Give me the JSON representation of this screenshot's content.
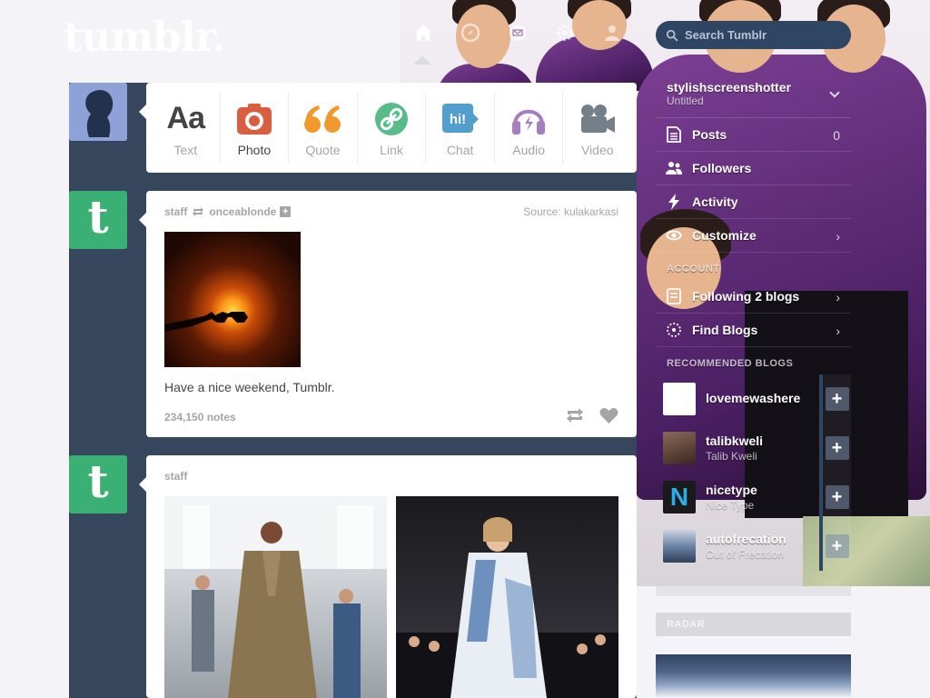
{
  "header": {
    "logo": "tumblr.",
    "search_placeholder": "Search Tumblr",
    "nav_icons": [
      "home-icon",
      "compass-icon",
      "mail-icon",
      "gear-icon",
      "user-icon"
    ]
  },
  "post_types": [
    {
      "label": "Text",
      "icon": "text-icon"
    },
    {
      "label": "Photo",
      "icon": "camera-icon"
    },
    {
      "label": "Quote",
      "icon": "quote-icon"
    },
    {
      "label": "Link",
      "icon": "link-icon"
    },
    {
      "label": "Chat",
      "icon": "chat-icon"
    },
    {
      "label": "Audio",
      "icon": "headphones-icon"
    },
    {
      "label": "Video",
      "icon": "video-camera-icon"
    }
  ],
  "posts": [
    {
      "author": "staff",
      "reblogged_from": "onceablonde",
      "source": "Source: kulakarkasi",
      "caption": "Have a nice weekend, Tumblr.",
      "notes": "234,150 notes"
    },
    {
      "author": "staff"
    }
  ],
  "sidebar": {
    "blog_name": "stylishscreenshotter",
    "blog_sub": "Untitled",
    "items": [
      {
        "label": "Posts",
        "icon": "posts-icon",
        "count": "0"
      },
      {
        "label": "Followers",
        "icon": "followers-icon"
      },
      {
        "label": "Activity",
        "icon": "lightning-icon"
      },
      {
        "label": "Customize",
        "icon": "eye-icon"
      }
    ],
    "account_heading": "ACCOUNT",
    "account_items": [
      {
        "label": "Following 2 blogs",
        "icon": "following-icon"
      },
      {
        "label": "Find Blogs",
        "icon": "find-blogs-icon"
      }
    ],
    "recommended_heading": "RECOMMENDED BLOGS",
    "recommended": [
      {
        "name": "lovemewashere",
        "sub": "",
        "thumb_color": "#ffffff"
      },
      {
        "name": "talibkweli",
        "sub": "Talib Kweli",
        "thumb_color": "#6b4b3e"
      },
      {
        "name": "nicetype",
        "sub": "Nice Type",
        "thumb_color": "#1a1a1a"
      },
      {
        "name": "autofrecation",
        "sub": "Out of Frecation",
        "thumb_color": "#7a8faa"
      }
    ],
    "radar_heading": "RADAR"
  },
  "colors": {
    "navy": "#36465d",
    "tumblr_green": "#3bb074",
    "photo_red": "#d95e40",
    "quote_orange": "#f2992e",
    "link_green": "#56bc8a",
    "chat_blue": "#529ecc",
    "audio_purple": "#a77dc2",
    "video_grey": "#748089"
  }
}
